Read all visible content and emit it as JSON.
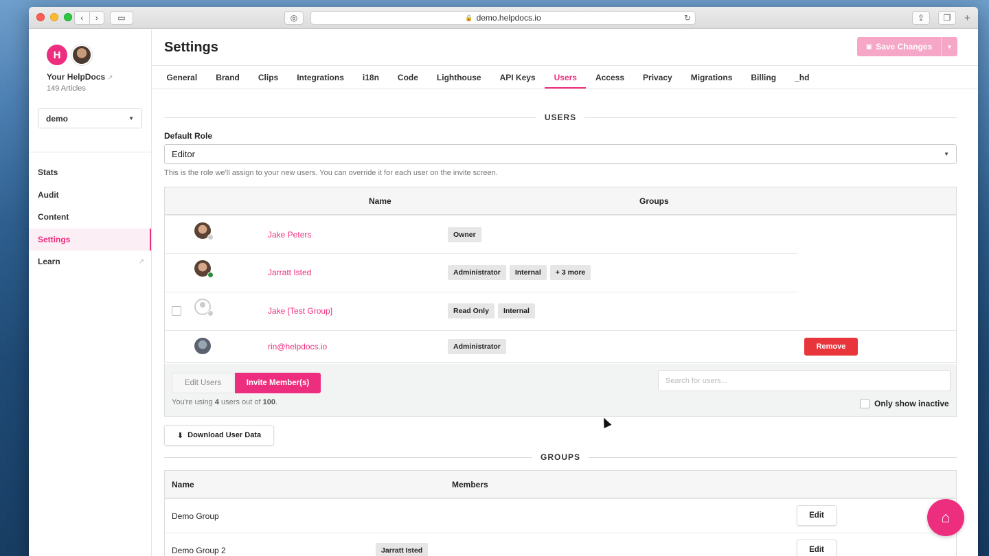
{
  "browser": {
    "url": "demo.helpdocs.io"
  },
  "sidebar": {
    "logo_text": "H",
    "site_name": "Your HelpDocs",
    "site_sub": "149 Articles",
    "site_select": "demo",
    "items": [
      {
        "label": "Stats"
      },
      {
        "label": "Audit"
      },
      {
        "label": "Content"
      },
      {
        "label": "Settings"
      },
      {
        "label": "Learn"
      }
    ]
  },
  "header": {
    "title": "Settings",
    "save_label": "Save Changes"
  },
  "tabs": [
    {
      "label": "General"
    },
    {
      "label": "Brand"
    },
    {
      "label": "Clips"
    },
    {
      "label": "Integrations"
    },
    {
      "label": "i18n"
    },
    {
      "label": "Code"
    },
    {
      "label": "Lighthouse"
    },
    {
      "label": "API Keys"
    },
    {
      "label": "Users"
    },
    {
      "label": "Access"
    },
    {
      "label": "Privacy"
    },
    {
      "label": "Migrations"
    },
    {
      "label": "Billing"
    },
    {
      "label": "_hd"
    }
  ],
  "users_section": {
    "heading": "USERS",
    "default_role_label": "Default Role",
    "default_role_value": "Editor",
    "hint": "This is the role we'll assign to your new users. You can override it for each user on the invite screen.",
    "columns": {
      "name": "Name",
      "groups": "Groups"
    },
    "rows": [
      {
        "name": "Jake Peters",
        "groups": [
          "Owner"
        ]
      },
      {
        "name": "Jarratt Isted",
        "groups": [
          "Administrator",
          "Internal",
          "+ 3 more"
        ]
      },
      {
        "name": "Jake [Test Group]",
        "groups": [
          "Read Only",
          "Internal"
        ]
      },
      {
        "name": "rin@helpdocs.io",
        "groups": [
          "Administrator"
        ],
        "action": "Remove"
      }
    ],
    "edit_users_label": "Edit Users",
    "invite_label": "Invite Member(s)",
    "usage_prefix": "You're using ",
    "usage_count": "4",
    "usage_mid": " users out of ",
    "usage_total": "100",
    "usage_suffix": ".",
    "search_placeholder": "Search for users...",
    "only_inactive_label": "Only show inactive",
    "download_label": "Download User Data"
  },
  "groups_section": {
    "heading": "GROUPS",
    "columns": {
      "name": "Name",
      "members": "Members"
    },
    "rows": [
      {
        "name": "Demo Group",
        "members": [],
        "action": "Edit"
      },
      {
        "name": "Demo Group 2",
        "members": [
          "Jarratt Isted"
        ],
        "action": "Edit"
      }
    ]
  },
  "colors": {
    "accent": "#ed2e7e",
    "danger": "#e8353c"
  }
}
